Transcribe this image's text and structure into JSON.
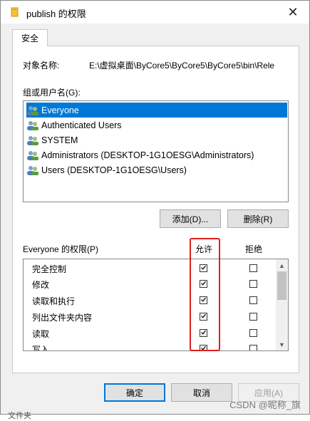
{
  "window": {
    "title": "publish 的权限",
    "close_glyph": "✕"
  },
  "tab": {
    "label": "安全"
  },
  "object": {
    "label": "对象名称:",
    "path": "E:\\虚拟桌面\\ByCore5\\ByCore5\\ByCore5\\bin\\Rele"
  },
  "groups": {
    "label": "组或用户名(G):",
    "items": [
      {
        "label": "Everyone",
        "selected": true
      },
      {
        "label": "Authenticated Users"
      },
      {
        "label": "SYSTEM"
      },
      {
        "label": "Administrators (DESKTOP-1G1OESG\\Administrators)"
      },
      {
        "label": "Users (DESKTOP-1G1OESG\\Users)"
      }
    ]
  },
  "buttons": {
    "add": "添加(D)...",
    "remove": "删除(R)",
    "ok": "确定",
    "cancel": "取消",
    "apply": "应用(A)"
  },
  "permissions": {
    "label": "Everyone 的权限(P)",
    "allow_header": "允许",
    "deny_header": "拒绝",
    "rows": [
      {
        "name": "完全控制",
        "allow": true,
        "deny": false
      },
      {
        "name": "修改",
        "allow": true,
        "deny": false
      },
      {
        "name": "读取和执行",
        "allow": true,
        "deny": false
      },
      {
        "name": "列出文件夹内容",
        "allow": true,
        "deny": false
      },
      {
        "name": "读取",
        "allow": true,
        "deny": false
      },
      {
        "name": "写入",
        "allow": true,
        "deny": false
      }
    ]
  },
  "watermark": "CSDN @昵称_旗",
  "bottom_text": "文件夹",
  "colors": {
    "selection": "#0078d7",
    "highlight_box": "#e02020",
    "title_icon": "#f2c23c"
  }
}
